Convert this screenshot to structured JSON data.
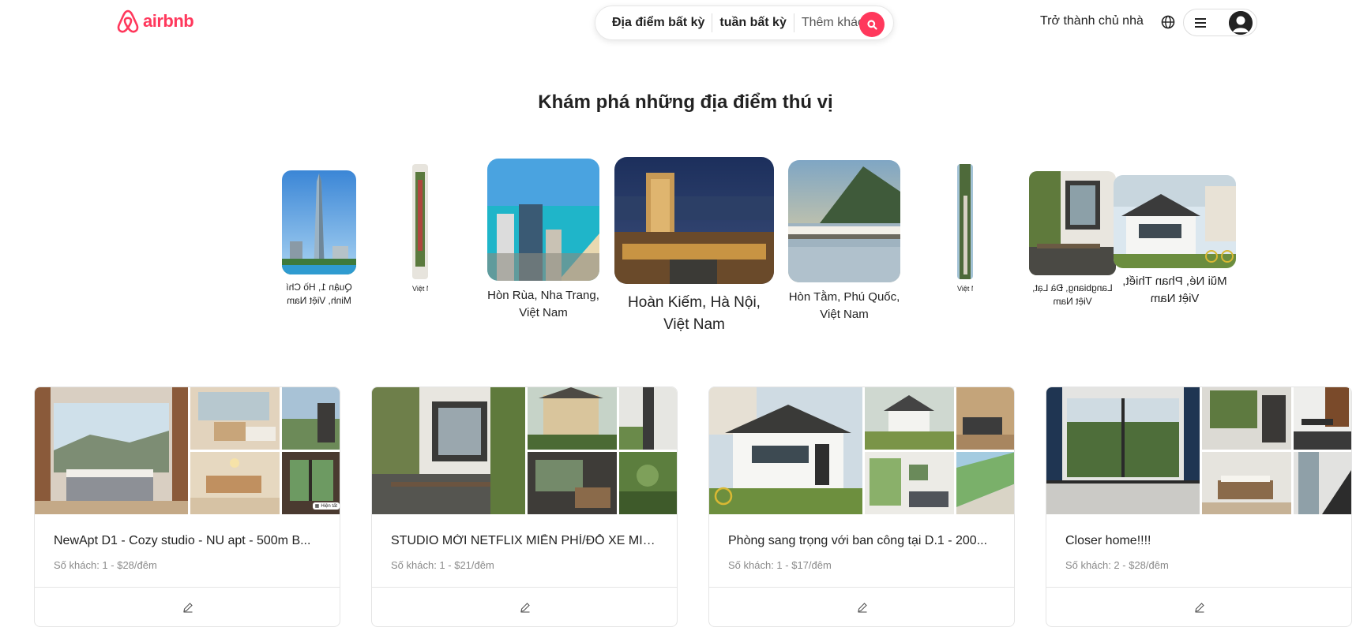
{
  "header": {
    "logo_text": "airbnb",
    "search": {
      "location": "Địa điểm bất kỳ",
      "week": "tuần bất kỳ",
      "guests": "Thêm khách"
    },
    "host_link": "Trở thành chủ nhà",
    "icons": [
      "airbnb-logo-icon",
      "search-icon",
      "globe-icon",
      "menu-icon",
      "user-avatar-icon"
    ]
  },
  "explore": {
    "title": "Khám phá những địa điểm thú vị",
    "destinations": [
      {
        "label": "Quận 1, Hồ Chí Minh, Việt Nam"
      },
      {
        "label": "Việt Nam"
      },
      {
        "label": "Hòn Rùa, Nha Trang, Việt Nam"
      },
      {
        "label": "Hoàn Kiếm, Hà Nội, Việt Nam"
      },
      {
        "label": "Hòn Tằm, Phú Quốc, Việt Nam"
      },
      {
        "label": "Việt Nam"
      },
      {
        "label": "Langbiang, Đà Lạt, Việt Nam"
      },
      {
        "label": "Mũi Né, Phan Thiết, Việt Nam"
      }
    ]
  },
  "listings": [
    {
      "title": "NewApt D1 - Cozy studio - NU apt - 500m B...",
      "meta": "Số khách: 1 - $28/đêm",
      "photo_badge": "Hiện tất"
    },
    {
      "title": "STUDIO MỚI NETFLIX MIỄN PHÍ/ĐỖ XE MIỄ...",
      "meta": "Số khách: 1 - $21/đêm"
    },
    {
      "title": "Phòng sang trọng với ban công tại D.1 - 200...",
      "meta": "Số khách: 1 - $17/đêm"
    },
    {
      "title": "Closer home!!!!",
      "meta": "Số khách: 2 - $28/đêm"
    }
  ],
  "colors": {
    "brand": "#ff385c",
    "text": "#222222",
    "muted": "#8a8a8a",
    "border": "#e5e5e5"
  }
}
